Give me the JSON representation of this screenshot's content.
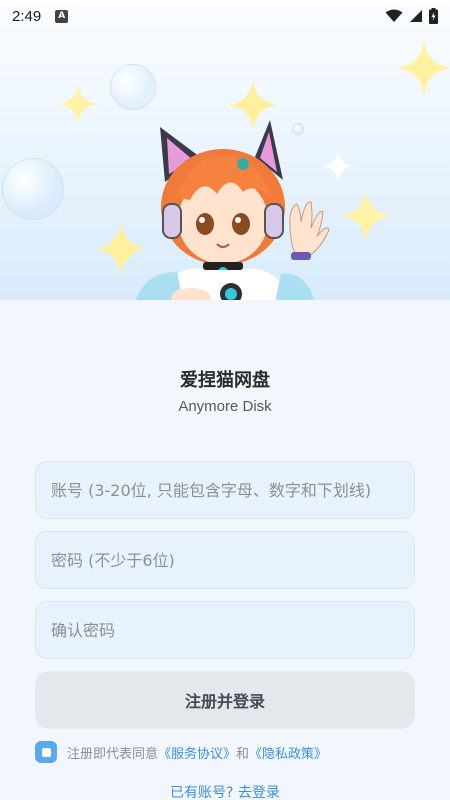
{
  "status_bar": {
    "time": "2:49",
    "a_badge": "A",
    "icons": [
      "wifi-icon",
      "signal-icon",
      "battery-icon"
    ]
  },
  "hero": {
    "illustration": "anime-cat-girl-waving"
  },
  "app": {
    "title": "爱捏猫网盘",
    "subtitle": "Anymore Disk"
  },
  "form": {
    "account_placeholder": "账号 (3-20位, 只能包含字母、数字和下划线)",
    "password_placeholder": "密码 (不少于6位)",
    "confirm_placeholder": "确认密码",
    "submit_label": "注册并登录"
  },
  "agreement": {
    "checked": true,
    "prefix": "注册即代表同意",
    "service_link": "《服务协议》",
    "and": "和",
    "privacy_link": "《隐私政策》"
  },
  "footer": {
    "login_link": "已有账号? 去登录"
  },
  "colors": {
    "accent": "#3b8fdc",
    "checkbox": "#5aa9ef",
    "field_bg": "#e8f2fd",
    "button_bg": "#e4e8ed"
  }
}
